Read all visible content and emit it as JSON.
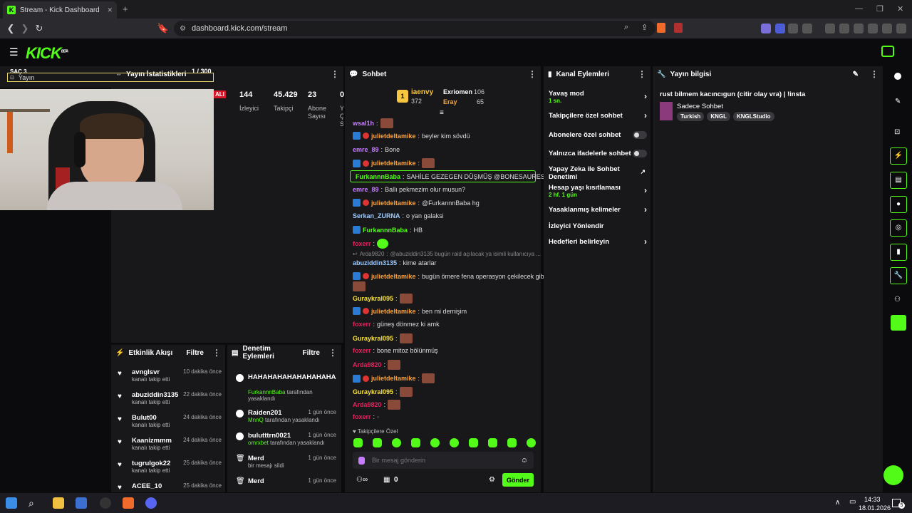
{
  "browser": {
    "tab_title": "Stream - Kick Dashboard",
    "url": "dashboard.kick.com/stream",
    "new_tab": "+",
    "close_tab": "✕"
  },
  "colors": {
    "accent": "#53fc18",
    "panel": "#18181b",
    "bg": "#0b0b0d"
  },
  "header": {
    "logo": "KICK",
    "beta": "BETA"
  },
  "scene": {
    "title": "SAÇ 3",
    "source": "Yayın"
  },
  "stats": {
    "title": "Yayın İstatistikleri",
    "page": "1 / 300",
    "live_badge": "ALI",
    "items": [
      {
        "value": "144",
        "label": "İzleyici"
      },
      {
        "value": "45.429",
        "label": "Takipçi"
      },
      {
        "value": "23",
        "label": "Abone Sayısı"
      },
      {
        "value": "0",
        "label": "Y Ç S"
      }
    ]
  },
  "chat": {
    "title": "Sohbet",
    "top_donors": [
      {
        "name": "iaenvy",
        "value": "372"
      },
      {
        "name": "Exriomen",
        "value": "106"
      },
      {
        "name": "Eray",
        "value": "65"
      }
    ],
    "messages": [
      {
        "user": "wsal1h",
        "color": "#c77dff",
        "text": ""
      },
      {
        "user": "julietdeltamike",
        "color": "#f7a440",
        "text": "beyler kim sövdü"
      },
      {
        "user": "emre_89",
        "color": "#c77dff",
        "text": "Bone"
      },
      {
        "user": "julietdeltamike",
        "color": "#f7a440",
        "text": ""
      },
      {
        "user": "FurkannnBaba",
        "color": "#53fc18",
        "text": "SAHİLE GEZEGEN DÜŞMÜŞ @BONESAURES"
      },
      {
        "user": "emre_89",
        "color": "#c77dff",
        "text": "Ballı pekmezim olur musun?"
      },
      {
        "user": "julietdeltamike",
        "color": "#f7a440",
        "text": "@FurkannnBaba hg"
      },
      {
        "user": "Serkan_ZURNA",
        "color": "#9ecbff",
        "text": "o yan galaksi"
      },
      {
        "user": "FurkannnBaba",
        "color": "#53fc18",
        "text": "HB"
      },
      {
        "user": "foxerr",
        "color": "#e0245e",
        "text": ""
      },
      {
        "user": "Arda9820",
        "color": "#888888",
        "text": "@abuziddin3135 bugün raid açılacak ya isimli kullanıcıya ..."
      },
      {
        "user": "abuziddin3135",
        "color": "#9ecbff",
        "text": "kime atarlar"
      },
      {
        "user": "julietdeltamike",
        "color": "#f7a440",
        "text": "bugün ömere fena operasyon çekilecek gibi"
      },
      {
        "user": "Guraykral095",
        "color": "#f7e140",
        "text": ""
      },
      {
        "user": "julietdeltamike",
        "color": "#f7a440",
        "text": "ben mi demişim"
      },
      {
        "user": "foxerr",
        "color": "#e0245e",
        "text": "güneş dönmez ki amk"
      },
      {
        "user": "Guraykral095",
        "color": "#f7e140",
        "text": ""
      },
      {
        "user": "foxerr",
        "color": "#e0245e",
        "text": "bone mitoz bölünmüş"
      },
      {
        "user": "Arda9820",
        "color": "#e0245e",
        "text": ""
      },
      {
        "user": "julietdeltamike",
        "color": "#f7a440",
        "text": ""
      },
      {
        "user": "Guraykral095",
        "color": "#f7e140",
        "text": ""
      },
      {
        "user": "Arda9820",
        "color": "#e0245e",
        "text": ""
      },
      {
        "user": "foxerr",
        "color": "#e0245e",
        "text": ""
      }
    ],
    "followers_only": "Takipçilere Özel",
    "input_placeholder": "Bir mesaj gönderin",
    "count": "0",
    "send": "Gönder"
  },
  "channel_actions": {
    "title": "Kanal Eylemleri",
    "items": [
      {
        "label": "Yavaş mod",
        "sub": "1 sn.",
        "control": "chevron"
      },
      {
        "label": "Takipçilere özel sohbet",
        "sub": "",
        "control": "chevron"
      },
      {
        "label": "Abonelere özel sohbet",
        "sub": "",
        "control": "toggle"
      },
      {
        "label": "Yalnızca ifadelerle sohbet",
        "sub": "",
        "control": "toggle"
      },
      {
        "label": "Yapay Zeka ile Sohbet Denetimi",
        "sub": "",
        "control": "external"
      },
      {
        "label": "Hesap yaşı kısıtlaması",
        "sub": "2 hf. 1 gün",
        "control": "chevron"
      },
      {
        "label": "Yasaklanmış kelimeler",
        "sub": "",
        "control": "chevron"
      },
      {
        "label": "İzleyici Yönlendir",
        "sub": "",
        "control": "none"
      },
      {
        "label": "Hedefleri belirleyin",
        "sub": "",
        "control": "chevron"
      }
    ]
  },
  "stream_info": {
    "title": "Yayın bilgisi",
    "stream_title": "rust bilmem kacıncıgun (citir olay vra) | !insta",
    "category": "Sadece Sohbet",
    "tags": [
      "Turkish",
      "KNGL",
      "KNGLStudio"
    ]
  },
  "activity": {
    "title": "Etkinlik Akışı",
    "filter": "Filtre",
    "items": [
      {
        "name": "avnglsvr",
        "sub": "kanalı takip etti",
        "time": "10 dakika önce"
      },
      {
        "name": "abuziddin3135",
        "sub": "kanalı takip etti",
        "time": "22 dakika önce"
      },
      {
        "name": "Bulut00",
        "sub": "kanalı takip etti",
        "time": "24 dakika önce"
      },
      {
        "name": "Kaanizmmm",
        "sub": "kanalı takip etti",
        "time": "24 dakika önce"
      },
      {
        "name": "tugrulgok22",
        "sub": "kanalı takip etti",
        "time": "25 dakika önce"
      },
      {
        "name": "ACEE_10",
        "sub": "",
        "time": "25 dakika önce"
      }
    ]
  },
  "moderation": {
    "title": "Denetim Eylemleri",
    "filter": "Filtre",
    "items": [
      {
        "name": "HAHAHAHAHAHAHAHAHAAAH",
        "actor": "FurkannnBaba",
        "action": "tarafından yasaklandı",
        "time": ""
      },
      {
        "name": "Raiden201",
        "actor": "MnnQ",
        "action": "tarafından yasaklandı",
        "time": "1 gün önce"
      },
      {
        "name": "bulutttrn0021",
        "actor": "omrxbet",
        "action": "tarafından yasaklandı",
        "time": "1 gün önce"
      },
      {
        "name": "Merd",
        "actor": "",
        "action": "bir mesajı sildi",
        "time": "1 gün önce"
      },
      {
        "name": "Merd",
        "actor": "",
        "action": "",
        "time": "1 gün önce"
      }
    ]
  },
  "taskbar": {
    "time": "14:33",
    "date": "18.01.2026",
    "notif": "5"
  }
}
